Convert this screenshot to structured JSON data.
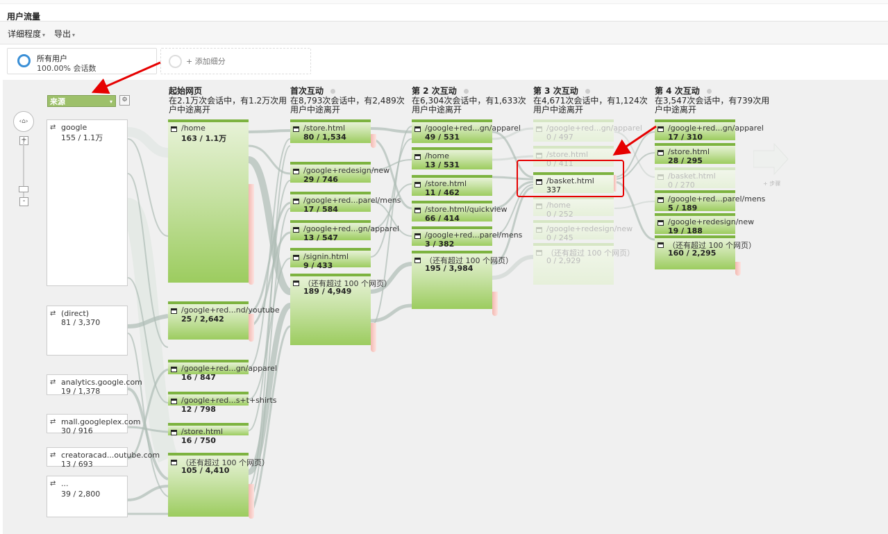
{
  "title": "用户流量",
  "toolbar": {
    "detail": "详细程度",
    "export": "导出"
  },
  "segments": {
    "all": {
      "name": "所有用户",
      "sub": "100.00% 会话数",
      "color": "#3a8fd6"
    },
    "add": "+ 添加细分"
  },
  "source_dimension": "来源",
  "columns": [
    {
      "title": "起始网页",
      "sub": "在2.1万次会话中，有1.2万次用户中途离开",
      "nodes": [
        {
          "label": "/home",
          "value": "163 / 1.1万"
        },
        {
          "label": "/google+red...nd/youtube",
          "value": "25 / 2,642"
        },
        {
          "label": "/google+red...gn/apparel",
          "value": "16 / 847"
        },
        {
          "label": "/google+red...s+t+shirts",
          "value": "12 / 798"
        },
        {
          "label": "/store.html",
          "value": "16 / 750"
        },
        {
          "label": "（还有超过 100 个网页）",
          "value": "105 / 4,410"
        }
      ]
    },
    {
      "title": "首次互动",
      "sub": "在8,793次会话中，有2,489次用户中途离开",
      "nodes": [
        {
          "label": "/store.html",
          "value": "80 / 1,534"
        },
        {
          "label": "/google+redesign/new",
          "value": "29 / 746"
        },
        {
          "label": "/google+red...parel/mens",
          "value": "17 / 584"
        },
        {
          "label": "/google+red...gn/apparel",
          "value": "13 / 547"
        },
        {
          "label": "/signin.html",
          "value": "9 / 433"
        },
        {
          "label": "（还有超过 100 个网页）",
          "value": "189 / 4,949"
        }
      ]
    },
    {
      "title": "第 2 次互动",
      "sub": "在6,304次会话中，有1,633次用户中途离开",
      "nodes": [
        {
          "label": "/google+red...gn/apparel",
          "value": "49 / 531"
        },
        {
          "label": "/home",
          "value": "13 / 531"
        },
        {
          "label": "/store.html",
          "value": "11 / 462"
        },
        {
          "label": "/store.html/quickview",
          "value": "66 / 414"
        },
        {
          "label": "/google+red...parel/mens",
          "value": "3 / 382"
        },
        {
          "label": "（还有超过 100 个网页）",
          "value": "195 / 3,984"
        }
      ]
    },
    {
      "title": "第 3 次互动",
      "sub": "在4,671次会话中，有1,124次用户中途离开",
      "nodes": [
        {
          "label": "/google+red...gn/apparel",
          "value": "0 / 497"
        },
        {
          "label": "/store.html",
          "value": "0 / 411"
        },
        {
          "label": "/basket.html",
          "value": "337"
        },
        {
          "label": "/home",
          "value": "0 / 252"
        },
        {
          "label": "/google+redesign/new",
          "value": "0 / 245"
        },
        {
          "label": "（还有超过 100 个网页）",
          "value": "0 / 2,929"
        }
      ]
    },
    {
      "title": "第 4 次互动",
      "sub": "在3,547次会话中，有739次用户中途离开",
      "nodes": [
        {
          "label": "/google+red...gn/apparel",
          "value": "17 / 310"
        },
        {
          "label": "/store.html",
          "value": "28 / 295"
        },
        {
          "label": "/basket.html",
          "value": "0 / 270"
        },
        {
          "label": "/google+red...parel/mens",
          "value": "5 / 189"
        },
        {
          "label": "/google+redesign/new",
          "value": "19 / 188"
        },
        {
          "label": "（还有超过 100 个网页）",
          "value": "160 / 2,295"
        }
      ]
    }
  ],
  "sources": [
    {
      "label": "google",
      "value": "155 / 1.1万"
    },
    {
      "label": "(direct)",
      "value": "81 / 3,370"
    },
    {
      "label": "analytics.google.com",
      "value": "19 / 1,378"
    },
    {
      "label": "mall.googleplex.com",
      "value": "30 / 916"
    },
    {
      "label": "creatoracad...outube.com",
      "value": "13 / 693"
    },
    {
      "label": "...",
      "value": "39 / 2,800"
    }
  ],
  "next_step": "+ 步骤",
  "colors": {
    "node": "#9ccc5f",
    "drop": "#f3b9b1",
    "highlight": "#e60000",
    "annotation": "#e60000"
  }
}
